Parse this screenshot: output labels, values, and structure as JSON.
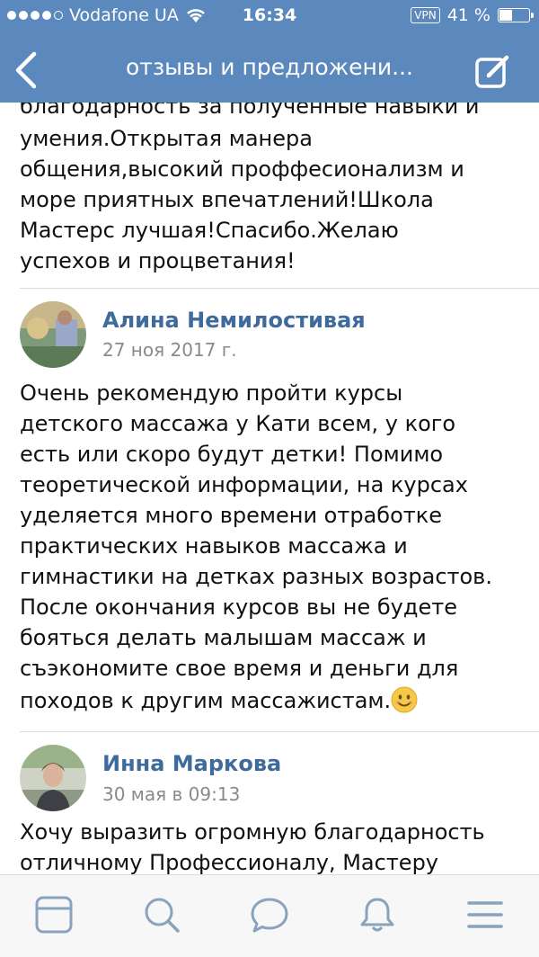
{
  "status": {
    "carrier": "Vodafone UA",
    "time": "16:34",
    "vpn": "VPN",
    "battery": "41 %"
  },
  "nav": {
    "title": "отзывы и предложени..."
  },
  "reviews": [
    {
      "text_top": "благодарность за полученные навыки и",
      "text": "умения.Открытая манера\nобщения,высокий проффесионализм и\nморе приятных впечатлений!Школа\nМастерс лучшая!Спасибо.Желаю\nуспехов и процветания!"
    },
    {
      "name": "Алина Немилостивая",
      "date": "27 ноя 2017 г.",
      "text": "Очень рекомендую пройти курсы\nдетского массажа у Кати всем, у кого\nесть или скоро будут детки! Помимо\nтеоретической информации, на курсах\nуделяется много времени отработке\nпрактических навыков массажа и\nгимнастики на детках разных возрастов.\nПосле окончания курсов вы не будете\nбояться делать малышам массаж и\nсъэкономите свое время и деньги для",
      "last_line": "походов к другим массажистам."
    },
    {
      "name": "Инна Маркова",
      "date": "30 мая в 09:13",
      "text": "Хочу выразить огромную благодарность\nотличному Профессионалу, Мастеру"
    }
  ],
  "tabs": [
    "news-icon",
    "search-icon",
    "messages-icon",
    "notifications-icon",
    "menu-icon"
  ],
  "colors": {
    "header": "#5b88bd",
    "name": "#3f6a9c",
    "tab_icon": "#8aa2bd"
  }
}
